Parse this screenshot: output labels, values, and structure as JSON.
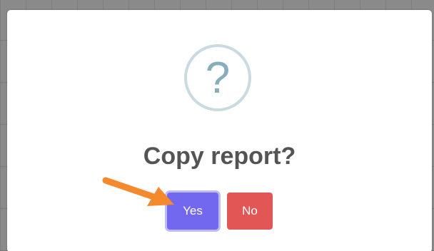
{
  "dialog": {
    "icon": "question-icon",
    "icon_glyph": "?",
    "title": "Copy report?",
    "confirm_label": "Yes",
    "cancel_label": "No"
  },
  "colors": {
    "confirm": "#7267ef",
    "cancel": "#e25656",
    "icon_ring": "#c9dae1",
    "icon_glyph": "#87adbd",
    "annotation_arrow": "#f58a2c"
  },
  "annotation": {
    "icon": "pointer-arrow-icon"
  }
}
